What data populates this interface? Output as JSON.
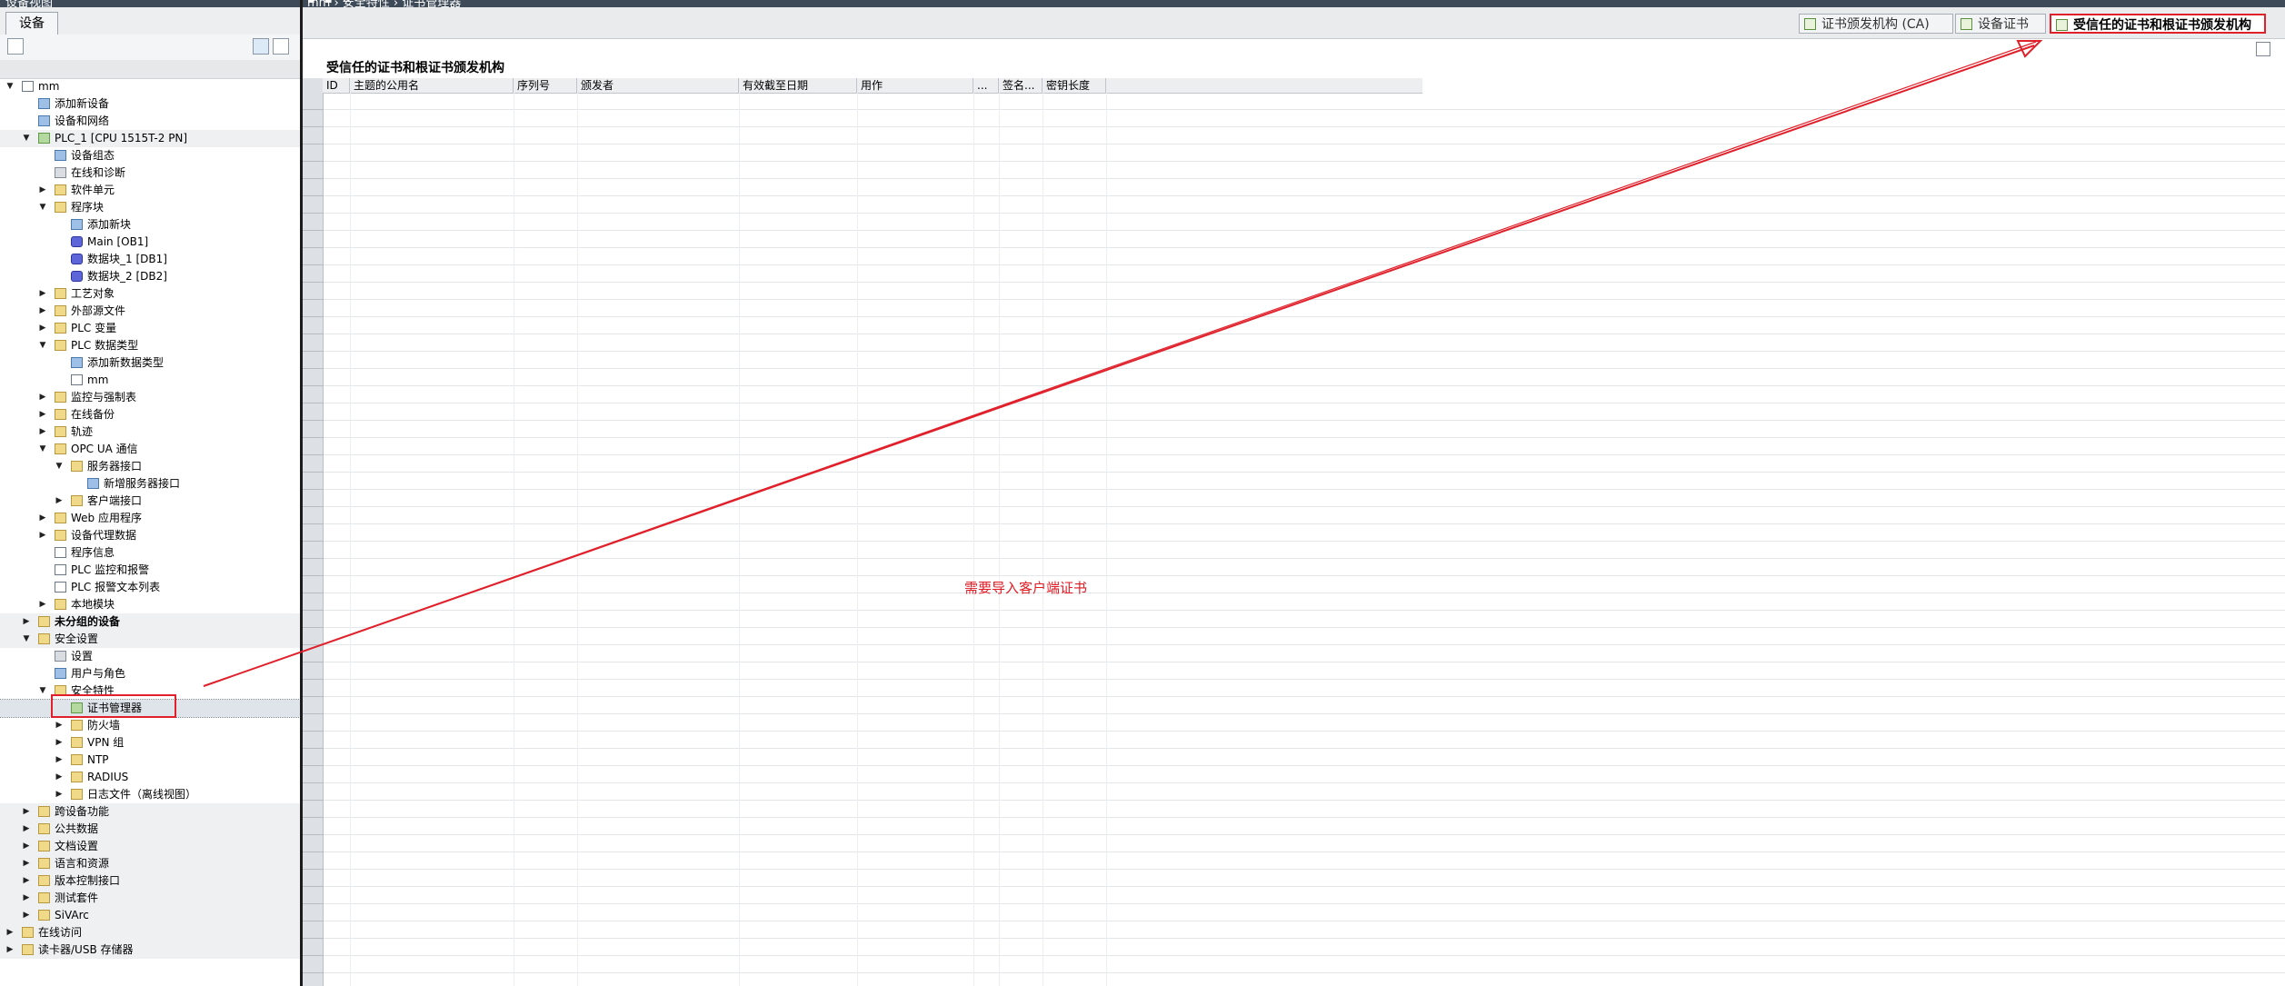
{
  "window": {
    "left_title": "设备视图",
    "right_title": "mm › 安全特性 › 证书管理器",
    "controls": "▪ ▪ ✕"
  },
  "left_panel": {
    "tab_label": "设备",
    "tree": [
      {
        "label": "mm",
        "indent": 0,
        "toggle": "▼",
        "icon": "project",
        "bold": false,
        "group": false
      },
      {
        "label": "添加新设备",
        "indent": 1,
        "toggle": "",
        "icon": "add-device",
        "bold": false,
        "group": false
      },
      {
        "label": "设备和网络",
        "indent": 1,
        "toggle": "",
        "icon": "network",
        "bold": false,
        "group": false
      },
      {
        "label": "PLC_1 [CPU 1515T-2 PN]",
        "indent": 1,
        "toggle": "▼",
        "icon": "plc",
        "bold": false,
        "group": true
      },
      {
        "label": "设备组态",
        "indent": 2,
        "toggle": "",
        "icon": "device-config",
        "bold": false,
        "group": false
      },
      {
        "label": "在线和诊断",
        "indent": 2,
        "toggle": "",
        "icon": "online-diag",
        "bold": false,
        "group": false
      },
      {
        "label": "软件单元",
        "indent": 2,
        "toggle": "▶",
        "icon": "folder",
        "bold": false,
        "group": false
      },
      {
        "label": "程序块",
        "indent": 2,
        "toggle": "▼",
        "icon": "folder",
        "bold": false,
        "group": false
      },
      {
        "label": "添加新块",
        "indent": 3,
        "toggle": "",
        "icon": "add-block",
        "bold": false,
        "group": false
      },
      {
        "label": "Main [OB1]",
        "indent": 3,
        "toggle": "",
        "icon": "ob",
        "bold": false,
        "group": false
      },
      {
        "label": "数据块_1 [DB1]",
        "indent": 3,
        "toggle": "",
        "icon": "db",
        "bold": false,
        "group": false
      },
      {
        "label": "数据块_2 [DB2]",
        "indent": 3,
        "toggle": "",
        "icon": "db",
        "bold": false,
        "group": false
      },
      {
        "label": "工艺对象",
        "indent": 2,
        "toggle": "▶",
        "icon": "folder",
        "bold": false,
        "group": false
      },
      {
        "label": "外部源文件",
        "indent": 2,
        "toggle": "▶",
        "icon": "folder",
        "bold": false,
        "group": false
      },
      {
        "label": "PLC 变量",
        "indent": 2,
        "toggle": "▶",
        "icon": "folder",
        "bold": false,
        "group": false
      },
      {
        "label": "PLC 数据类型",
        "indent": 2,
        "toggle": "▼",
        "icon": "folder",
        "bold": false,
        "group": false
      },
      {
        "label": "添加新数据类型",
        "indent": 3,
        "toggle": "",
        "icon": "add-type",
        "bold": false,
        "group": false
      },
      {
        "label": "mm",
        "indent": 3,
        "toggle": "",
        "icon": "udt",
        "bold": false,
        "group": false
      },
      {
        "label": "监控与强制表",
        "indent": 2,
        "toggle": "▶",
        "icon": "folder",
        "bold": false,
        "group": false
      },
      {
        "label": "在线备份",
        "indent": 2,
        "toggle": "▶",
        "icon": "folder",
        "bold": false,
        "group": false
      },
      {
        "label": "轨迹",
        "indent": 2,
        "toggle": "▶",
        "icon": "folder",
        "bold": false,
        "group": false
      },
      {
        "label": "OPC UA 通信",
        "indent": 2,
        "toggle": "▼",
        "icon": "folder",
        "bold": false,
        "group": false
      },
      {
        "label": "服务器接口",
        "indent": 3,
        "toggle": "▼",
        "icon": "folder",
        "bold": false,
        "group": false
      },
      {
        "label": "新增服务器接口",
        "indent": 4,
        "toggle": "",
        "icon": "add-interface",
        "bold": false,
        "group": false
      },
      {
        "label": "客户端接口",
        "indent": 3,
        "toggle": "▶",
        "icon": "folder",
        "bold": false,
        "group": false
      },
      {
        "label": "Web 应用程序",
        "indent": 2,
        "toggle": "▶",
        "icon": "folder",
        "bold": false,
        "group": false
      },
      {
        "label": "设备代理数据",
        "indent": 2,
        "toggle": "▶",
        "icon": "folder",
        "bold": false,
        "group": false
      },
      {
        "label": "程序信息",
        "indent": 2,
        "toggle": "",
        "icon": "doc",
        "bold": false,
        "group": false
      },
      {
        "label": "PLC 监控和报警",
        "indent": 2,
        "toggle": "",
        "icon": "doc",
        "bold": false,
        "group": false
      },
      {
        "label": "PLC 报警文本列表",
        "indent": 2,
        "toggle": "",
        "icon": "doc",
        "bold": false,
        "group": false
      },
      {
        "label": "本地模块",
        "indent": 2,
        "toggle": "▶",
        "icon": "folder",
        "bold": false,
        "group": false
      },
      {
        "label": "未分组的设备",
        "indent": 1,
        "toggle": "▶",
        "icon": "folder",
        "bold": true,
        "group": true
      },
      {
        "label": "安全设置",
        "indent": 1,
        "toggle": "▼",
        "icon": "security",
        "bold": false,
        "group": true
      },
      {
        "label": "设置",
        "indent": 2,
        "toggle": "",
        "icon": "settings",
        "bold": false,
        "group": false
      },
      {
        "label": "用户与角色",
        "indent": 2,
        "toggle": "",
        "icon": "users",
        "bold": false,
        "group": false
      },
      {
        "label": "安全特性",
        "indent": 2,
        "toggle": "▼",
        "icon": "folder",
        "bold": false,
        "group": false
      },
      {
        "label": "证书管理器",
        "indent": 3,
        "toggle": "",
        "icon": "cert",
        "bold": false,
        "group": false,
        "selected": true
      },
      {
        "label": "防火墙",
        "indent": 3,
        "toggle": "▶",
        "icon": "folder",
        "bold": false,
        "group": false
      },
      {
        "label": "VPN 组",
        "indent": 3,
        "toggle": "▶",
        "icon": "folder",
        "bold": false,
        "group": false
      },
      {
        "label": "NTP",
        "indent": 3,
        "toggle": "▶",
        "icon": "folder",
        "bold": false,
        "group": false
      },
      {
        "label": "RADIUS",
        "indent": 3,
        "toggle": "▶",
        "icon": "folder",
        "bold": false,
        "group": false
      },
      {
        "label": "日志文件（离线视图）",
        "indent": 3,
        "toggle": "▶",
        "icon": "folder",
        "bold": false,
        "group": false
      },
      {
        "label": "跨设备功能",
        "indent": 1,
        "toggle": "▶",
        "icon": "folder",
        "bold": false,
        "group": true
      },
      {
        "label": "公共数据",
        "indent": 1,
        "toggle": "▶",
        "icon": "folder",
        "bold": false,
        "group": true
      },
      {
        "label": "文档设置",
        "indent": 1,
        "toggle": "▶",
        "icon": "folder",
        "bold": false,
        "group": true
      },
      {
        "label": "语言和资源",
        "indent": 1,
        "toggle": "▶",
        "icon": "folder",
        "bold": false,
        "group": true
      },
      {
        "label": "版本控制接口",
        "indent": 1,
        "toggle": "▶",
        "icon": "folder",
        "bold": false,
        "group": true
      },
      {
        "label": "测试套件",
        "indent": 1,
        "toggle": "▶",
        "icon": "folder",
        "bold": false,
        "group": true
      },
      {
        "label": "SiVArc",
        "indent": 1,
        "toggle": "▶",
        "icon": "folder",
        "bold": false,
        "group": true
      },
      {
        "label": "在线访问",
        "indent": 0,
        "toggle": "▶",
        "icon": "folder",
        "bold": false,
        "group": true
      },
      {
        "label": "读卡器/USB 存储器",
        "indent": 0,
        "toggle": "▶",
        "icon": "folder",
        "bold": false,
        "group": true
      }
    ]
  },
  "right_area": {
    "tabs": [
      {
        "label": "证书颁发机构 (CA)",
        "active": false
      },
      {
        "label": "设备证书",
        "active": false
      },
      {
        "label": "受信任的证书和根证书颁发机构",
        "active": true
      }
    ],
    "table_title": "受信任的证书和根证书颁发机构",
    "columns": [
      "ID",
      "主题的公用名",
      "序列号",
      "颁发者",
      "有效截至日期",
      "用作",
      "...",
      "签名...",
      "密钥长度"
    ],
    "rows": [],
    "annotation": "需要导入客户端证书"
  },
  "colors": {
    "highlight_red": "#e0202a",
    "title_bar": "#3e4a58",
    "note_red": "#e11a23"
  }
}
